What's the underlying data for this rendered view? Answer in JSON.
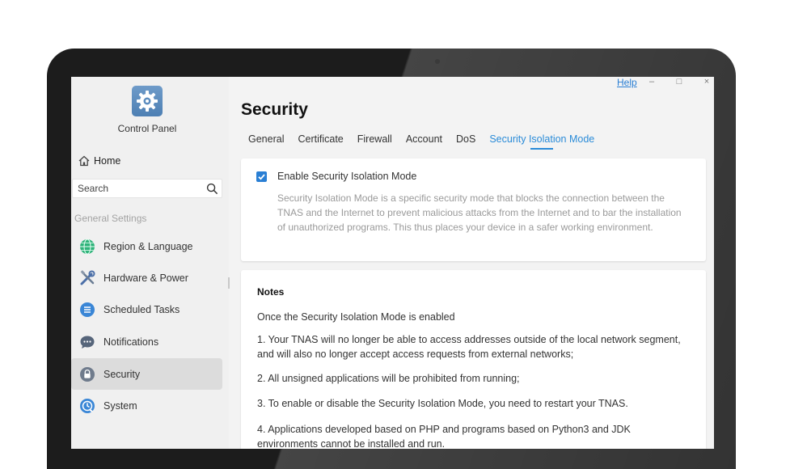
{
  "window": {
    "help_label": "Help",
    "minimize_glyph": "–",
    "maximize_glyph": "□",
    "close_glyph": "×"
  },
  "sidebar": {
    "app_title": "Control Panel",
    "app_icon": "gear-icon",
    "home_label": "Home",
    "home_icon": "home-icon",
    "search": {
      "placeholder": "Search",
      "value": ""
    },
    "section_label": "General Settings",
    "items": [
      {
        "label": "Region & Language",
        "icon": "globe-icon",
        "active": false
      },
      {
        "label": "Hardware & Power",
        "icon": "tools-icon",
        "active": false
      },
      {
        "label": "Scheduled Tasks",
        "icon": "scheduled-tasks-icon",
        "active": false
      },
      {
        "label": "Notifications",
        "icon": "chat-bubble-icon",
        "active": false
      },
      {
        "label": "Security",
        "icon": "lock-icon",
        "active": true
      },
      {
        "label": "System",
        "icon": "system-clock-icon",
        "active": false
      }
    ]
  },
  "main": {
    "title": "Security",
    "tabs": [
      {
        "label": "General",
        "active": false
      },
      {
        "label": "Certificate",
        "active": false
      },
      {
        "label": "Firewall",
        "active": false
      },
      {
        "label": "Account",
        "active": false
      },
      {
        "label": "DoS",
        "active": false
      },
      {
        "label": "Security Isolation Mode",
        "active": true
      }
    ],
    "isolation": {
      "checkbox_label": "Enable Security Isolation Mode",
      "checked": true,
      "description": "Security Isolation Mode is a specific security mode that blocks the connection between the TNAS and the Internet to prevent malicious attacks from the Internet and to bar the installation of unauthorized programs. This thus places your device in a safer working environment."
    },
    "notes": {
      "title": "Notes",
      "intro": "Once the Security Isolation Mode is enabled",
      "items": [
        "1. Your TNAS will no longer be able to access addresses outside of the local network segment, and will also no longer accept access requests from external networks;",
        "2. All unsigned applications will be prohibited from running;",
        "3. To enable or disable the Security Isolation Mode, you need to restart your TNAS.",
        "4. Applications developed based on PHP and programs based on Python3 and JDK environments cannot be installed and run."
      ]
    }
  },
  "colors": {
    "accent": "#2a8bd8",
    "link": "#2a7fd4",
    "sidebar_bg": "#f0f0f0",
    "active_item_bg": "#dcdcdc",
    "bezel": "#1c1c1c"
  }
}
